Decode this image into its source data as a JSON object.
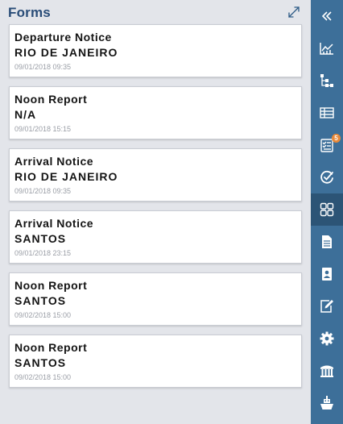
{
  "panel": {
    "title": "Forms",
    "expand_icon": "expand-arrows-icon"
  },
  "forms": [
    {
      "type": "Departure Notice",
      "location": "RIO DE JANEIRO",
      "timestamp": "09/01/2018 09:35"
    },
    {
      "type": "Noon Report",
      "location": "N/A",
      "timestamp": "09/01/2018 15:15"
    },
    {
      "type": "Arrival Notice",
      "location": "RIO DE JANEIRO",
      "timestamp": "09/01/2018 09:35"
    },
    {
      "type": "Arrival Notice",
      "location": "SANTOS",
      "timestamp": "09/01/2018 23:15"
    },
    {
      "type": "Noon Report",
      "location": "SANTOS",
      "timestamp": "09/02/2018 15:00"
    },
    {
      "type": "Noon Report",
      "location": "SANTOS",
      "timestamp": "09/02/2018 15:00"
    }
  ],
  "sidebar": {
    "items": [
      {
        "icon": "collapse-double-chevron-icon"
      },
      {
        "icon": "line-chart-icon"
      },
      {
        "icon": "hierarchy-tree-icon"
      },
      {
        "icon": "table-icon"
      },
      {
        "icon": "checklist-icon",
        "badge": "5"
      },
      {
        "icon": "gauge-check-icon"
      },
      {
        "icon": "forms-grid-icon",
        "active": true
      },
      {
        "icon": "document-icon"
      },
      {
        "icon": "contact-card-icon"
      },
      {
        "icon": "edit-note-icon"
      },
      {
        "icon": "settings-gear-icon"
      },
      {
        "icon": "archive-icon"
      },
      {
        "icon": "ship-icon"
      }
    ]
  },
  "colors": {
    "sidebar_bg": "#3d6f99",
    "sidebar_active": "#2c5476",
    "title": "#2a4d78",
    "badge": "#e88a3a",
    "panel_bg": "#e3e5ea"
  }
}
